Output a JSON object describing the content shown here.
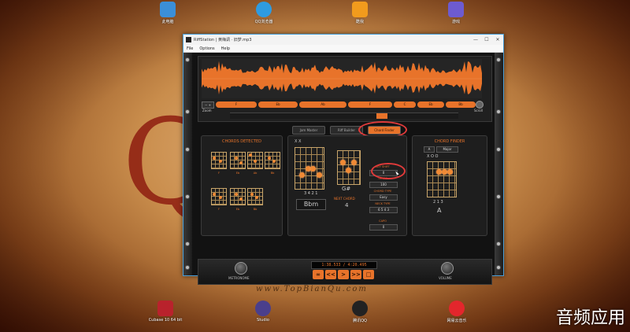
{
  "desktop": {
    "icons_top": [
      {
        "label": "此电脑"
      },
      {
        "label": "QQ浏览器"
      },
      {
        "label": "酷我"
      },
      {
        "label": "游戏"
      }
    ],
    "icons_bottom": [
      {
        "label": "Cubase 10 64 bit"
      },
      {
        "label": "Studio"
      },
      {
        "label": "腾讯QQ"
      },
      {
        "label": "网易云音乐"
      }
    ],
    "watermark": "www.TopBianQu.com",
    "corner_text": "音频应用",
    "colors": {
      "accent": "#e8732a",
      "highlight": "#e03a3a"
    }
  },
  "window": {
    "title": "RiffStation | 黄梅调 · 旧梦.mp3",
    "menu": [
      "File",
      "Options",
      "Help"
    ],
    "controls": [
      "—",
      "☐",
      "✕"
    ]
  },
  "waveform": {
    "zoom_label": "Zoom",
    "scroll_label": "Scroll",
    "chords": [
      "F",
      "Eb",
      "Ab",
      "F",
      "C",
      "Eb",
      "Bb"
    ]
  },
  "tabs": [
    "Jam Master",
    "Riff Builder",
    "Chord Finder"
  ],
  "chords_detected": {
    "title": "CHORDS DETECTED",
    "mini": [
      "F",
      "Eb",
      "Ab",
      "Bb",
      "F",
      "Eb",
      "Bb"
    ]
  },
  "current": {
    "muted": "X X",
    "fingers": "3 4 2 1",
    "name": "Bbm",
    "next_label": "NEXT CHORD",
    "next_name": "G#",
    "next_number": "4"
  },
  "settings": {
    "key_shift_label": "KEY SHIFT",
    "key_shift": "0",
    "tempo_label": "TEMPO",
    "tempo": "100",
    "chord_type_label": "CHORD TYPE",
    "chord_type": "Easy",
    "neck_type_label": "NECK TYPE",
    "neck_type": "6 5 4 3",
    "capo_label": "CAPO",
    "capo": "0"
  },
  "chord_finder": {
    "title": "CHORD FINDER",
    "root": "A",
    "quality": "Major",
    "open": "X O O",
    "fingers": "2 1 3",
    "name": "A"
  },
  "transport": {
    "time": "1:38.533 / 4:20.495",
    "buttons": [
      "∞",
      "<<",
      ">",
      ">>",
      "□"
    ],
    "metronome_label": "METRONOME",
    "volume_label": "VOLUME"
  }
}
